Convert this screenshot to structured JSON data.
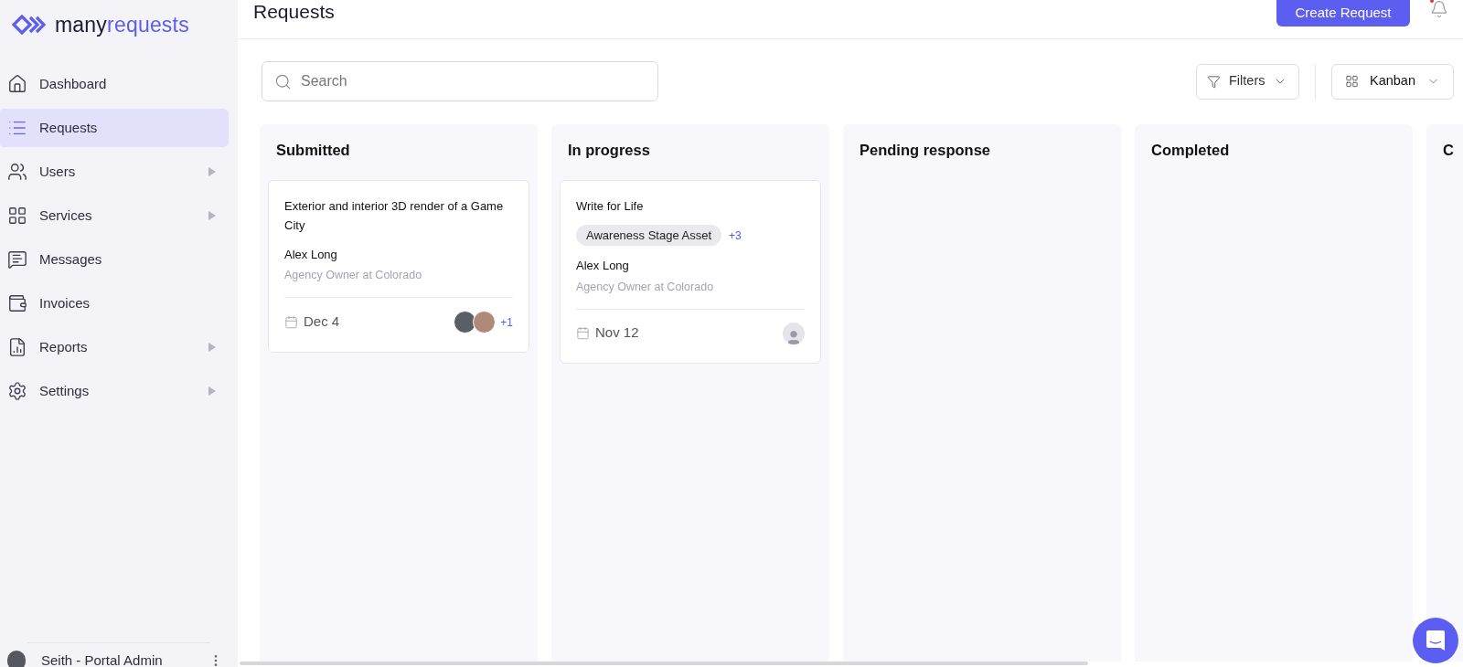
{
  "brand": {
    "part_1": "many",
    "part_2": "requests"
  },
  "sidebar": {
    "items": [
      {
        "label": "Dashboard",
        "selected": false,
        "has_submenu": false
      },
      {
        "label": "Requests",
        "selected": true,
        "has_submenu": false
      },
      {
        "label": "Users",
        "selected": false,
        "has_submenu": true
      },
      {
        "label": "Services",
        "selected": false,
        "has_submenu": true
      },
      {
        "label": "Messages",
        "selected": false,
        "has_submenu": false
      },
      {
        "label": "Invoices",
        "selected": false,
        "has_submenu": false
      },
      {
        "label": "Reports",
        "selected": false,
        "has_submenu": true
      },
      {
        "label": "Settings",
        "selected": false,
        "has_submenu": true
      }
    ],
    "user": {
      "name": "Seith - Portal Admin"
    }
  },
  "header": {
    "title": "Requests",
    "create_button": "Create Request",
    "notification_dot": true
  },
  "toolbar": {
    "search": {
      "placeholder": "Search"
    },
    "filters": "Filters",
    "view": "Kanban"
  },
  "columns": [
    {
      "title": "Submitted",
      "cards": [
        {
          "title": "Exterior and interior 3D render of a Game City",
          "name": "Alex Long",
          "role": "Agency Owner at Colorado",
          "date": "Dec 4",
          "assignees": [
            {
              "kind": "photo"
            },
            {
              "kind": "photo"
            }
          ],
          "more_assignees": "+1"
        }
      ]
    },
    {
      "title": "In progress",
      "cards": [
        {
          "title": "Write for Life",
          "tags": [
            "Awareness Stage Asset"
          ],
          "more_tags": "+3",
          "name": "Alex Long",
          "role": "Agency Owner at Colorado",
          "date": "Nov 12",
          "assignees": [
            {
              "kind": "placeholder"
            }
          ]
        }
      ]
    },
    {
      "title": "Pending response"
    },
    {
      "title": "Completed"
    },
    {
      "title": "C"
    }
  ]
}
